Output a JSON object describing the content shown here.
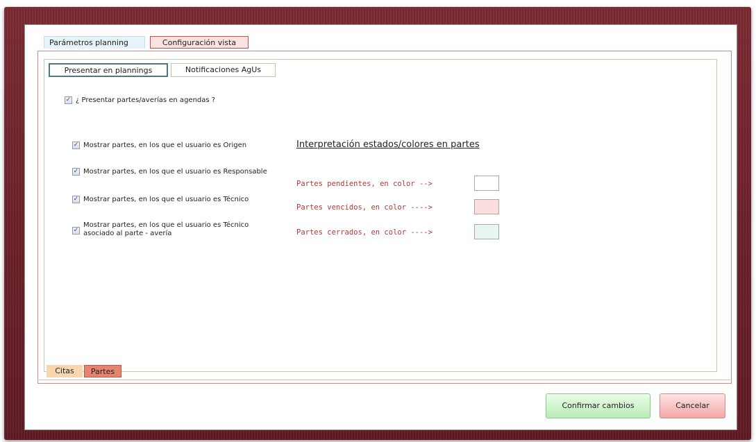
{
  "tabs": {
    "planning_params": "Parámetros planning",
    "view_config": "Configuración vista"
  },
  "subtabs": {
    "present": "Presentar en plannings",
    "notifications": "Notificaciones AgUs"
  },
  "present_checkbox": {
    "label": "¿ Presentar partes/averías en agendas ?",
    "checked": true
  },
  "options": [
    {
      "label": "Mostrar partes, en los que el usuario es Origen",
      "checked": true
    },
    {
      "label": "Mostrar partes, en los que el usuario es Responsable",
      "checked": true
    },
    {
      "label": "Mostrar partes, en los que el usuario es Técnico",
      "checked": true
    },
    {
      "label": "Mostrar partes, en los que el usuario es Técnico asociado al parte - avería",
      "checked": true
    }
  ],
  "legend": {
    "heading": "Interpretación estados/colores en partes",
    "pending": {
      "label": "Partes pendientes, en color -->",
      "color": "#ffffff"
    },
    "overdue": {
      "label": "Partes vencidos, en color ---->",
      "color": "#fcdede"
    },
    "closed": {
      "label": "Partes cerrados, en color ---->",
      "color": "#e8f6f0"
    }
  },
  "bottom_tabs": {
    "citas": "Citas",
    "partes": "Partes"
  },
  "buttons": {
    "confirm": "Confirmar cambios",
    "cancel": "Cancelar"
  },
  "checkmark": "✓"
}
